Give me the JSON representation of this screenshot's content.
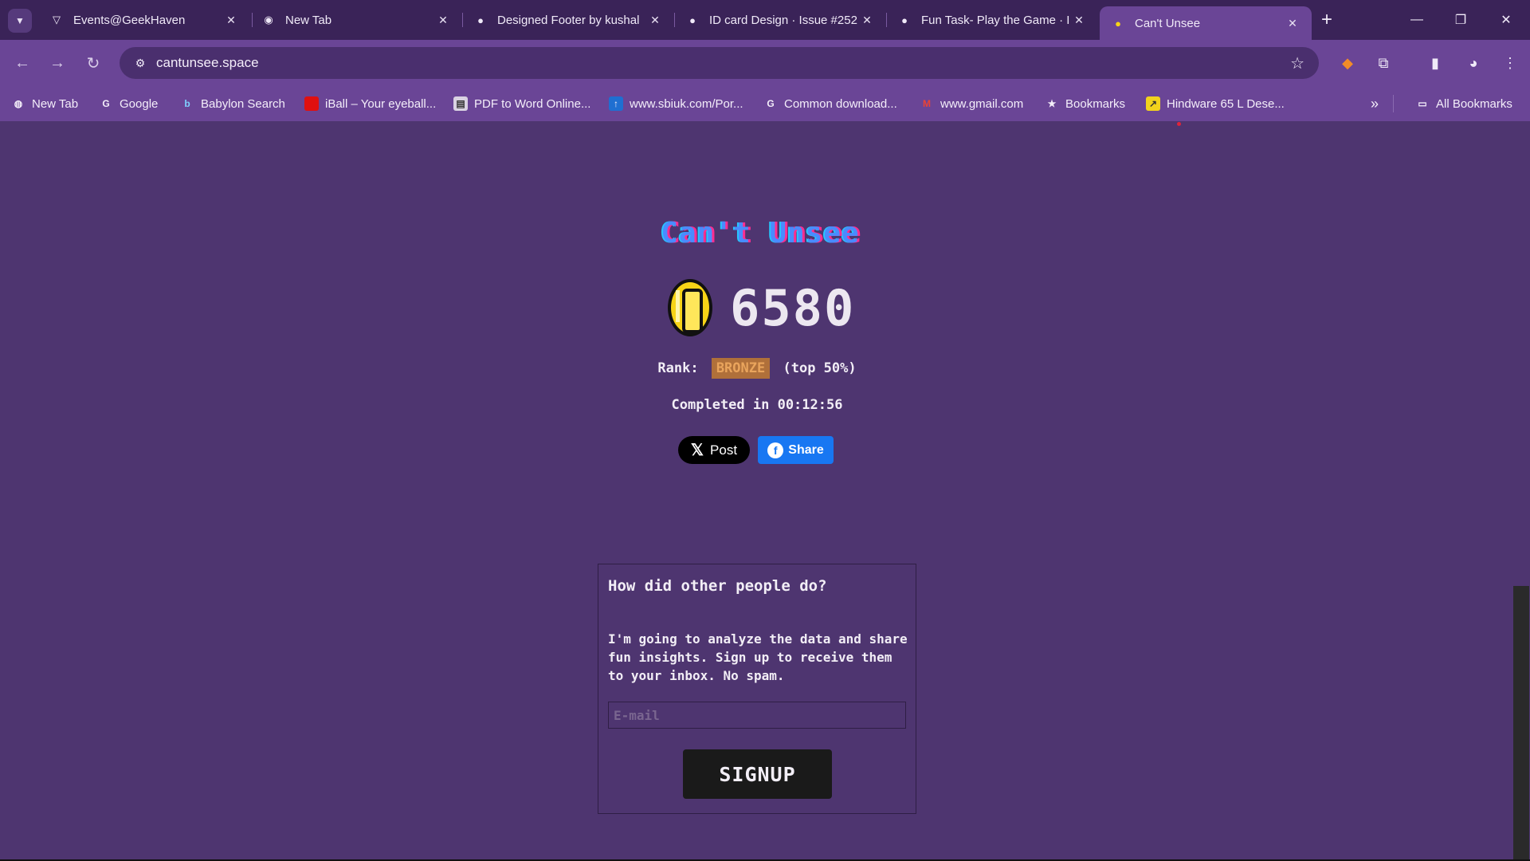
{
  "browser": {
    "tabs": [
      {
        "title": "Events@GeekHaven",
        "icon": "brave-icon",
        "active": false
      },
      {
        "title": "New Tab",
        "icon": "chrome-icon",
        "active": false
      },
      {
        "title": "Designed Footer by kushal",
        "icon": "github-icon",
        "active": false
      },
      {
        "title": "ID card Design · Issue #252",
        "icon": "github-icon",
        "active": false
      },
      {
        "title": "Fun Task- Play the Game · I",
        "icon": "github-icon",
        "active": false
      },
      {
        "title": "Can't Unsee",
        "icon": "coin-icon",
        "active": true
      }
    ],
    "url": "cantunsee.space",
    "bookmarks": [
      {
        "label": "New Tab",
        "icon": "globe-icon"
      },
      {
        "label": "Google",
        "icon": "google-icon"
      },
      {
        "label": "Babylon Search",
        "icon": "babylon-icon"
      },
      {
        "label": "iBall – Your eyeball...",
        "icon": "iball-icon"
      },
      {
        "label": "PDF to Word Online...",
        "icon": "pdf-icon"
      },
      {
        "label": "www.sbiuk.com/Por...",
        "icon": "sbi-icon"
      },
      {
        "label": "Common download...",
        "icon": "google-icon"
      },
      {
        "label": "www.gmail.com",
        "icon": "gmail-icon"
      },
      {
        "label": "Bookmarks",
        "icon": "star-icon"
      },
      {
        "label": "Hindware 65 L Dese...",
        "icon": "hindware-icon"
      }
    ],
    "all_bookmarks_label": "All Bookmarks"
  },
  "game": {
    "title": "Can't Unsee",
    "score": "6580",
    "rank_label": "Rank:",
    "rank_value": "BRONZE",
    "rank_percentile": "(top 50%)",
    "completed_text": "Completed in 00:12:56",
    "x_button_label": "Post",
    "fb_button_label": "Share"
  },
  "signup_panel": {
    "heading": "How did other people do?",
    "body": "I'm going to analyze the data and share fun insights. Sign up to receive them to your inbox. No spam.",
    "email_placeholder": "E-mail",
    "button_label": "SIGNUP"
  },
  "colors": {
    "page_bg": "#4e3570",
    "toolbar_bg": "#6a4596",
    "rank_badge": "#b0703a",
    "facebook_blue": "#1877f2"
  }
}
